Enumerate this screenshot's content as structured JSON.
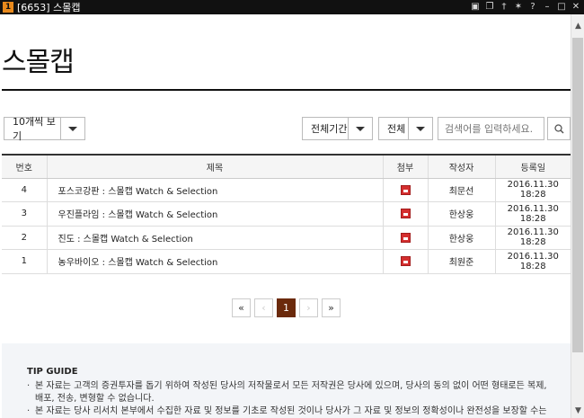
{
  "window": {
    "app_number": "1",
    "title": "[6653] 스몰캡"
  },
  "page": {
    "title": "스몰캡"
  },
  "toolbar": {
    "per_page": "10개씩 보기",
    "period": "전체기간",
    "scope": "전체",
    "search_placeholder": "검색어를 입력하세요."
  },
  "table": {
    "headers": [
      "번호",
      "제목",
      "첨부",
      "작성자",
      "등록일"
    ],
    "rows": [
      {
        "no": "4",
        "title": "포스코강판 : 스몰캡 Watch & Selection",
        "author": "최문선",
        "date": "2016.11.30 18:28"
      },
      {
        "no": "3",
        "title": "우진플라임 : 스몰캡 Watch & Selection",
        "author": "한상웅",
        "date": "2016.11.30 18:28"
      },
      {
        "no": "2",
        "title": "진도 : 스몰캡 Watch & Selection",
        "author": "한상웅",
        "date": "2016.11.30 18:28"
      },
      {
        "no": "1",
        "title": "농우바이오 : 스몰캡 Watch & Selection",
        "author": "최원준",
        "date": "2016.11.30 18:28"
      }
    ]
  },
  "pagination": {
    "first": "«",
    "prev": "‹",
    "current": "1",
    "next": "›",
    "last": "»"
  },
  "tip": {
    "heading": "TIP GUIDE",
    "items": [
      "본 자료는 고객의 증권투자를 돕기 위하여 작성된 당사의 저작물로서 모든 저작권은 당사에 있으며, 당사의 동의 없이 어떤 형태로든 복제, 배포, 전송, 변형할 수 없습니다.",
      "본 자료는 당사 리서치 본부에서 수집한 자료 및 정보를 기초로 작성된 것이나 당사가 그 자료 및 정보의 정확성이나 완전성을 보장할 수는 없으므로"
    ]
  },
  "icons": {
    "pdf_color": "#d42f2f",
    "accent": "#6b2a0c"
  }
}
